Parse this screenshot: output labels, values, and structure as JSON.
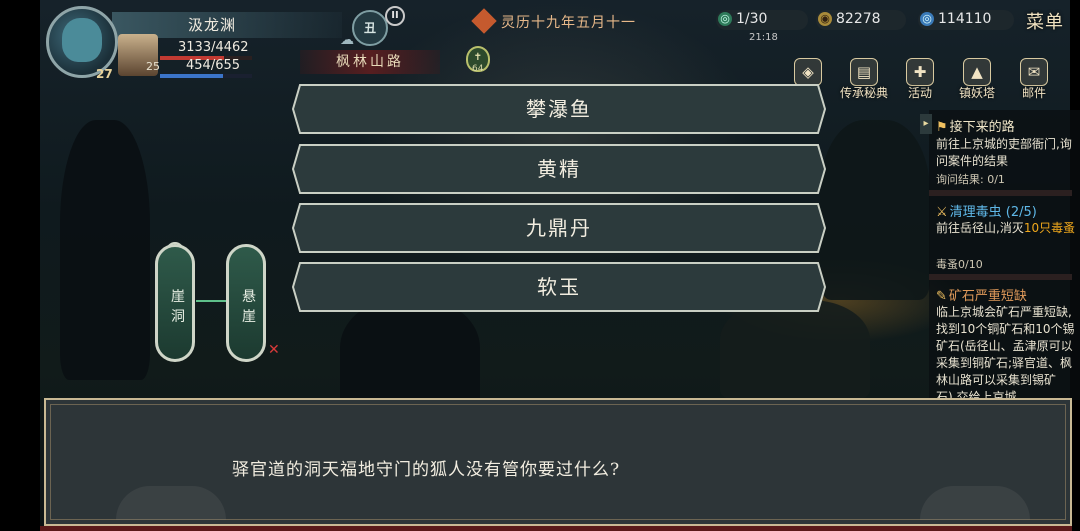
{
  "player": {
    "name": "汲龙渊",
    "level": "27",
    "hp": "3133/4462",
    "hp_fraction": 0.7,
    "mp": "454/655",
    "mp_fraction": 0.69,
    "pet_level": "25"
  },
  "time_badge": "丑",
  "location": "枫林山路",
  "calendar": "灵历十九年五月十一",
  "medal_value": "64",
  "resources": {
    "stamina": "1/30",
    "coins": "82278",
    "jade": "114110"
  },
  "clock": "21:18",
  "menu_label": "菜单",
  "features": [
    {
      "label": "宝箱",
      "icon": "chest-icon"
    },
    {
      "label": "传承秘典",
      "icon": "book-icon"
    },
    {
      "label": "活动",
      "icon": "gift-icon"
    },
    {
      "label": "镇妖塔",
      "icon": "tower-icon"
    },
    {
      "label": "邮件",
      "icon": "mail-icon"
    }
  ],
  "quests": [
    {
      "title": "接下来的路",
      "body": "前往上京城的吏部衙门,询问案件的结果",
      "progress": "询问结果: 0/1"
    },
    {
      "title": "清理毒虫 (2/5)",
      "body_prefix": "前往岳径山,消灭",
      "body_highlight": "10只毒蚤",
      "progress": "毒蚤0/10"
    },
    {
      "title": "矿石严重短缺",
      "body": "临上京城会矿石严重短缺,找到10个铜矿石和10个锡矿石(岳径山、孟津原可以采集到铜矿石;驿官道、枫林山路可以采集到锡矿石),交给上京城"
    }
  ],
  "map_nodes": [
    "崖洞",
    "悬崖"
  ],
  "choices": [
    "攀瀑鱼",
    "黄精",
    "九鼎丹",
    "软玉"
  ],
  "dialog_text": "驿官道的洞天福地守门的狐人没有管你要过什么?",
  "colors": {
    "panel_border": "#c9b994",
    "choice_fill": "#2c3a3c",
    "hp": "#c23a32",
    "mp": "#3b74c9",
    "quest_highlight": "#f0a81c"
  }
}
